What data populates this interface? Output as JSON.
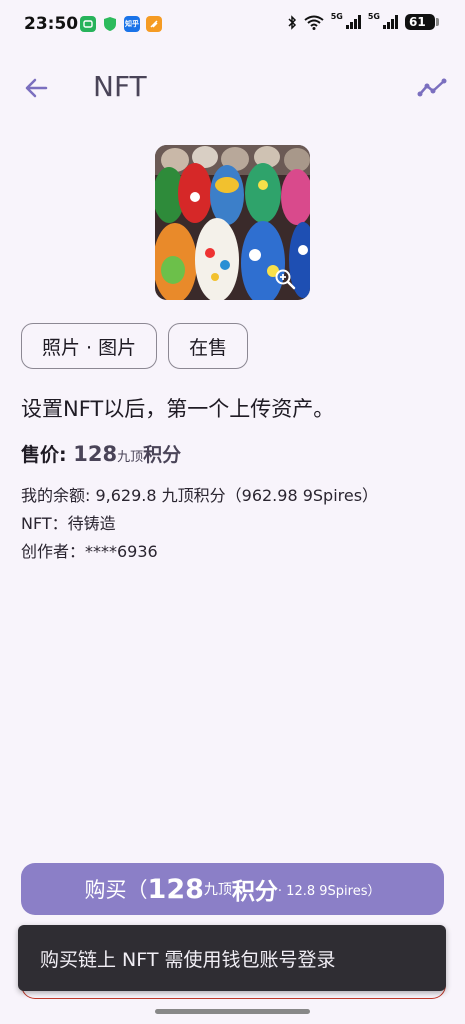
{
  "status_bar": {
    "time": "23:50",
    "battery": "61",
    "network_1": "5G",
    "network_2": "5G",
    "app_icons": [
      "mi-icon",
      "shield-icon",
      "zhihu-icon",
      "orange-app-icon"
    ],
    "zhihu_label": "知乎"
  },
  "app_bar": {
    "title": "NFT",
    "back_icon": "arrow-left-icon",
    "action_icon": "trend-line-icon"
  },
  "asset": {
    "image_icon": "ceramic-vases-image",
    "zoom_icon": "zoom-in-icon"
  },
  "chips": {
    "category": "照片 · 图片",
    "status": "在售"
  },
  "description": "设置NFT以后，第一个上传资产。",
  "price": {
    "label": "售价: ",
    "amount": "128",
    "unit_small": "九顶",
    "unit_big": "积分"
  },
  "info": {
    "balance": "我的余额: 9,629.8 九顶积分（962.98 9Spires）",
    "nft_status": "NFT：待铸造",
    "creator": "创作者：****6936"
  },
  "buy_button": {
    "prefix": "购买（",
    "amount": "128",
    "unit_small": "九顶",
    "unit_big": "积分",
    "suffix": " · 12.8 9Spires）"
  },
  "snackbar": {
    "message": "购买链上 NFT 需使用钱包账号登录"
  },
  "colors": {
    "accent": "#8b7fc7",
    "background": "#f8f4fb",
    "snackbar": "#2f2d33"
  }
}
